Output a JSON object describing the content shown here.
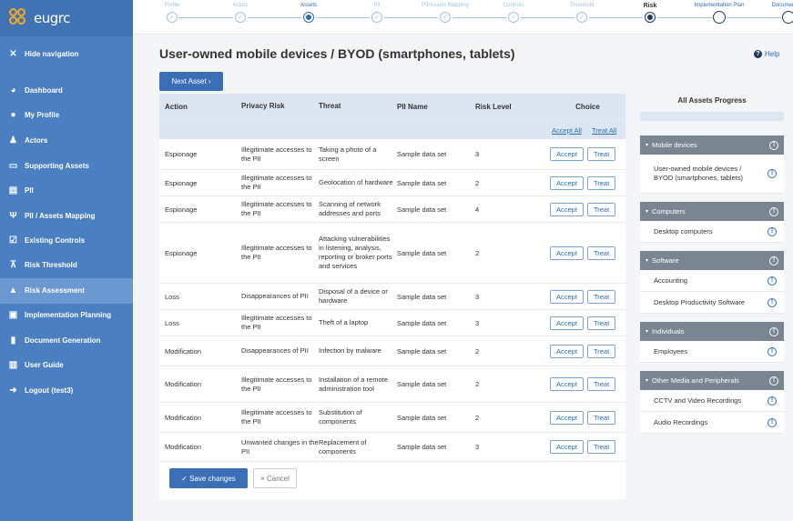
{
  "app": {
    "logo_text": "eugrc"
  },
  "sidebar": {
    "items": [
      {
        "label": "Hide navigation",
        "icon": "close-icon"
      },
      {
        "label": "Dashboard",
        "icon": "dashboard-icon"
      },
      {
        "label": "My Profile",
        "icon": "user-icon"
      },
      {
        "label": "Actors",
        "icon": "actors-icon"
      },
      {
        "label": "Supporting Assets",
        "icon": "assets-icon"
      },
      {
        "label": "PII",
        "icon": "pii-icon"
      },
      {
        "label": "PII / Assets Mapping",
        "icon": "mapping-icon"
      },
      {
        "label": "Existing Controls",
        "icon": "checkbox-icon"
      },
      {
        "label": "Risk Threshold",
        "icon": "threshold-icon"
      },
      {
        "label": "Risk Assessment",
        "icon": "warning-icon"
      },
      {
        "label": "Implementation Planning",
        "icon": "calendar-icon"
      },
      {
        "label": "Document Generation",
        "icon": "document-icon"
      },
      {
        "label": "User Guide",
        "icon": "book-icon"
      },
      {
        "label": "Logout (test3)",
        "icon": "logout-icon"
      }
    ],
    "active_index": 9
  },
  "stepper": {
    "steps": [
      {
        "label": "Profile",
        "state": "done"
      },
      {
        "label": "Actors",
        "state": "done"
      },
      {
        "label": "Assets",
        "state": "current"
      },
      {
        "label": "PII",
        "state": "done"
      },
      {
        "label": "PII/Assets Mapping",
        "state": "done"
      },
      {
        "label": "Controls",
        "state": "done"
      },
      {
        "label": "Threshold",
        "state": "done"
      },
      {
        "label": "Risk",
        "state": "active"
      },
      {
        "label": "Implementation Plan",
        "state": "future"
      },
      {
        "label": "Documentatio",
        "state": "future"
      }
    ],
    "check_glyph": "✓"
  },
  "main": {
    "title": "User-owned mobile devices / BYOD (smartphones, tablets)",
    "help_label": "Help",
    "next_label": "Next Asset ›",
    "table": {
      "headers": [
        "Action",
        "Privacy Risk",
        "Threat",
        "PII Name",
        "Risk Level",
        "Choice"
      ],
      "accept_all": "Accept All",
      "treat_all": "Treat All",
      "accept_label": "Accept",
      "treat_label": "Treat",
      "rows": [
        {
          "action": "Espionage",
          "risk": "Illegitimate accesses to the PII",
          "threat": "Taking a photo of a screen",
          "pii": "Sample data set",
          "level": "3"
        },
        {
          "action": "Espionage",
          "risk": "Illegitimate accesses to the PII",
          "threat": "Geolocation of hardware",
          "pii": "Sample data set",
          "level": "2"
        },
        {
          "action": "Espionage",
          "risk": "Illegitimate accesses to the PII",
          "threat": "Scanning of network addresses and ports",
          "pii": "Sample data set",
          "level": "4"
        },
        {
          "action": "Espionage",
          "risk": "Illegitimate accesses to the PII",
          "threat": "Attacking vulnerabilities in listening, analysis, reporting or broker ports and services",
          "pii": "Sample data set",
          "level": "2"
        },
        {
          "action": "Loss",
          "risk": "Disappearances of PII",
          "threat": "Disposal of a device or hardware",
          "pii": "Sample data set",
          "level": "3"
        },
        {
          "action": "Loss",
          "risk": "Illegitimate accesses to the PII",
          "threat": "Theft of a laptop",
          "pii": "Sample data set",
          "level": "3"
        },
        {
          "action": "Modification",
          "risk": "Disappearances of PII",
          "threat": "Infection by malware",
          "pii": "Sample data set",
          "level": "2"
        },
        {
          "action": "Modification",
          "risk": "Illegitimate accesses to the PII",
          "threat": "Installation of a remote administration tool",
          "pii": "Sample data set",
          "level": "2"
        },
        {
          "action": "Modification",
          "risk": "Illegitimate accesses to the PII",
          "threat": "Substitution of components",
          "pii": "Sample data set",
          "level": "2"
        },
        {
          "action": "Modification",
          "risk": "Unwanted changes in the PII",
          "threat": "Replacement of components",
          "pii": "Sample data set",
          "level": "3"
        }
      ]
    },
    "save_label": "✓ Save changes",
    "cancel_label": "× Cancel"
  },
  "progress": {
    "title": "All Assets Progress",
    "value": 0,
    "groups": [
      {
        "name": "Mobile devices",
        "items": [
          "User-owned mobile devices / BYOD (smartphones, tablets)"
        ]
      },
      {
        "name": "Computers",
        "items": [
          "Desktop computers"
        ]
      },
      {
        "name": "Software",
        "items": [
          "Accounting",
          "Desktop Productivity Software"
        ]
      },
      {
        "name": "Individuals",
        "items": [
          "Employees"
        ]
      },
      {
        "name": "Other Media and Peripherals",
        "items": [
          "CCTV and Video Recordings",
          "Audio Recordings"
        ]
      }
    ]
  },
  "colors": {
    "sidebar": "#4a7fc1",
    "accent": "#3a6fb8",
    "panel_header": "#7a8592"
  }
}
